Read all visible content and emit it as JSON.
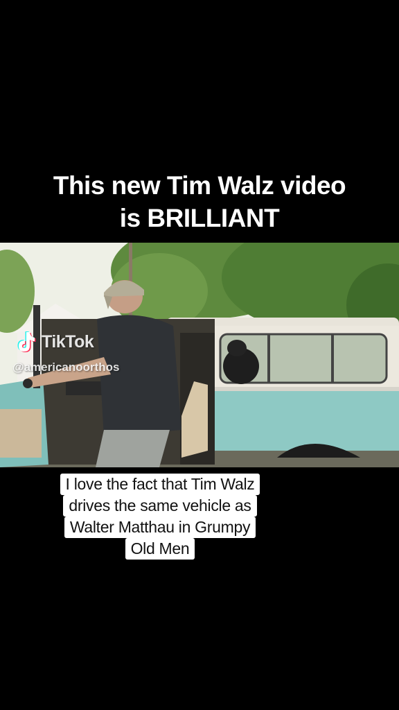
{
  "headline": {
    "line1": "This new Tim Walz video",
    "line2": "is BRILLIANT"
  },
  "watermark": {
    "brand": "TikTok",
    "handle": "@americanoorthos",
    "logo_icon": "tiktok-logo-icon"
  },
  "caption": {
    "lines": [
      "I love the fact that Tim Walz",
      "drives the same vehicle as",
      "Walter Matthau in Grumpy",
      "Old Men"
    ]
  },
  "colors": {
    "background": "#000000",
    "caption_bg": "#ffffff",
    "truck_teal": "#8ec9c4",
    "truck_roof": "#e8e4da"
  }
}
